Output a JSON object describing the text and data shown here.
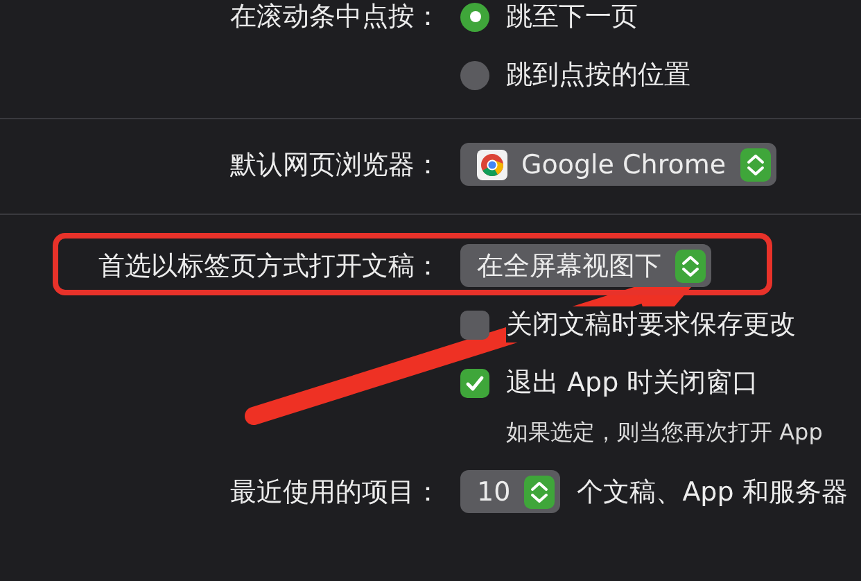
{
  "scroll_click": {
    "label": "在滚动条中点按：",
    "options": [
      {
        "label": "跳至下一页",
        "selected": true
      },
      {
        "label": "跳到点按的位置",
        "selected": false
      }
    ]
  },
  "default_browser": {
    "label": "默认网页浏览器：",
    "value": "Google Chrome"
  },
  "prefer_tabs": {
    "label": "首选以标签页方式打开文稿：",
    "value": "在全屏幕视图下"
  },
  "checkboxes": [
    {
      "label": "关闭文稿时要求保存更改",
      "checked": false
    },
    {
      "label": "退出 App 时关闭窗口",
      "checked": true
    }
  ],
  "note": "如果选定，则当您再次打开 App",
  "recent_items": {
    "label": "最近使用的项目：",
    "value": "10",
    "suffix": "个文稿、App 和服务器"
  },
  "highlight_box": true,
  "pointer_arrow": true
}
